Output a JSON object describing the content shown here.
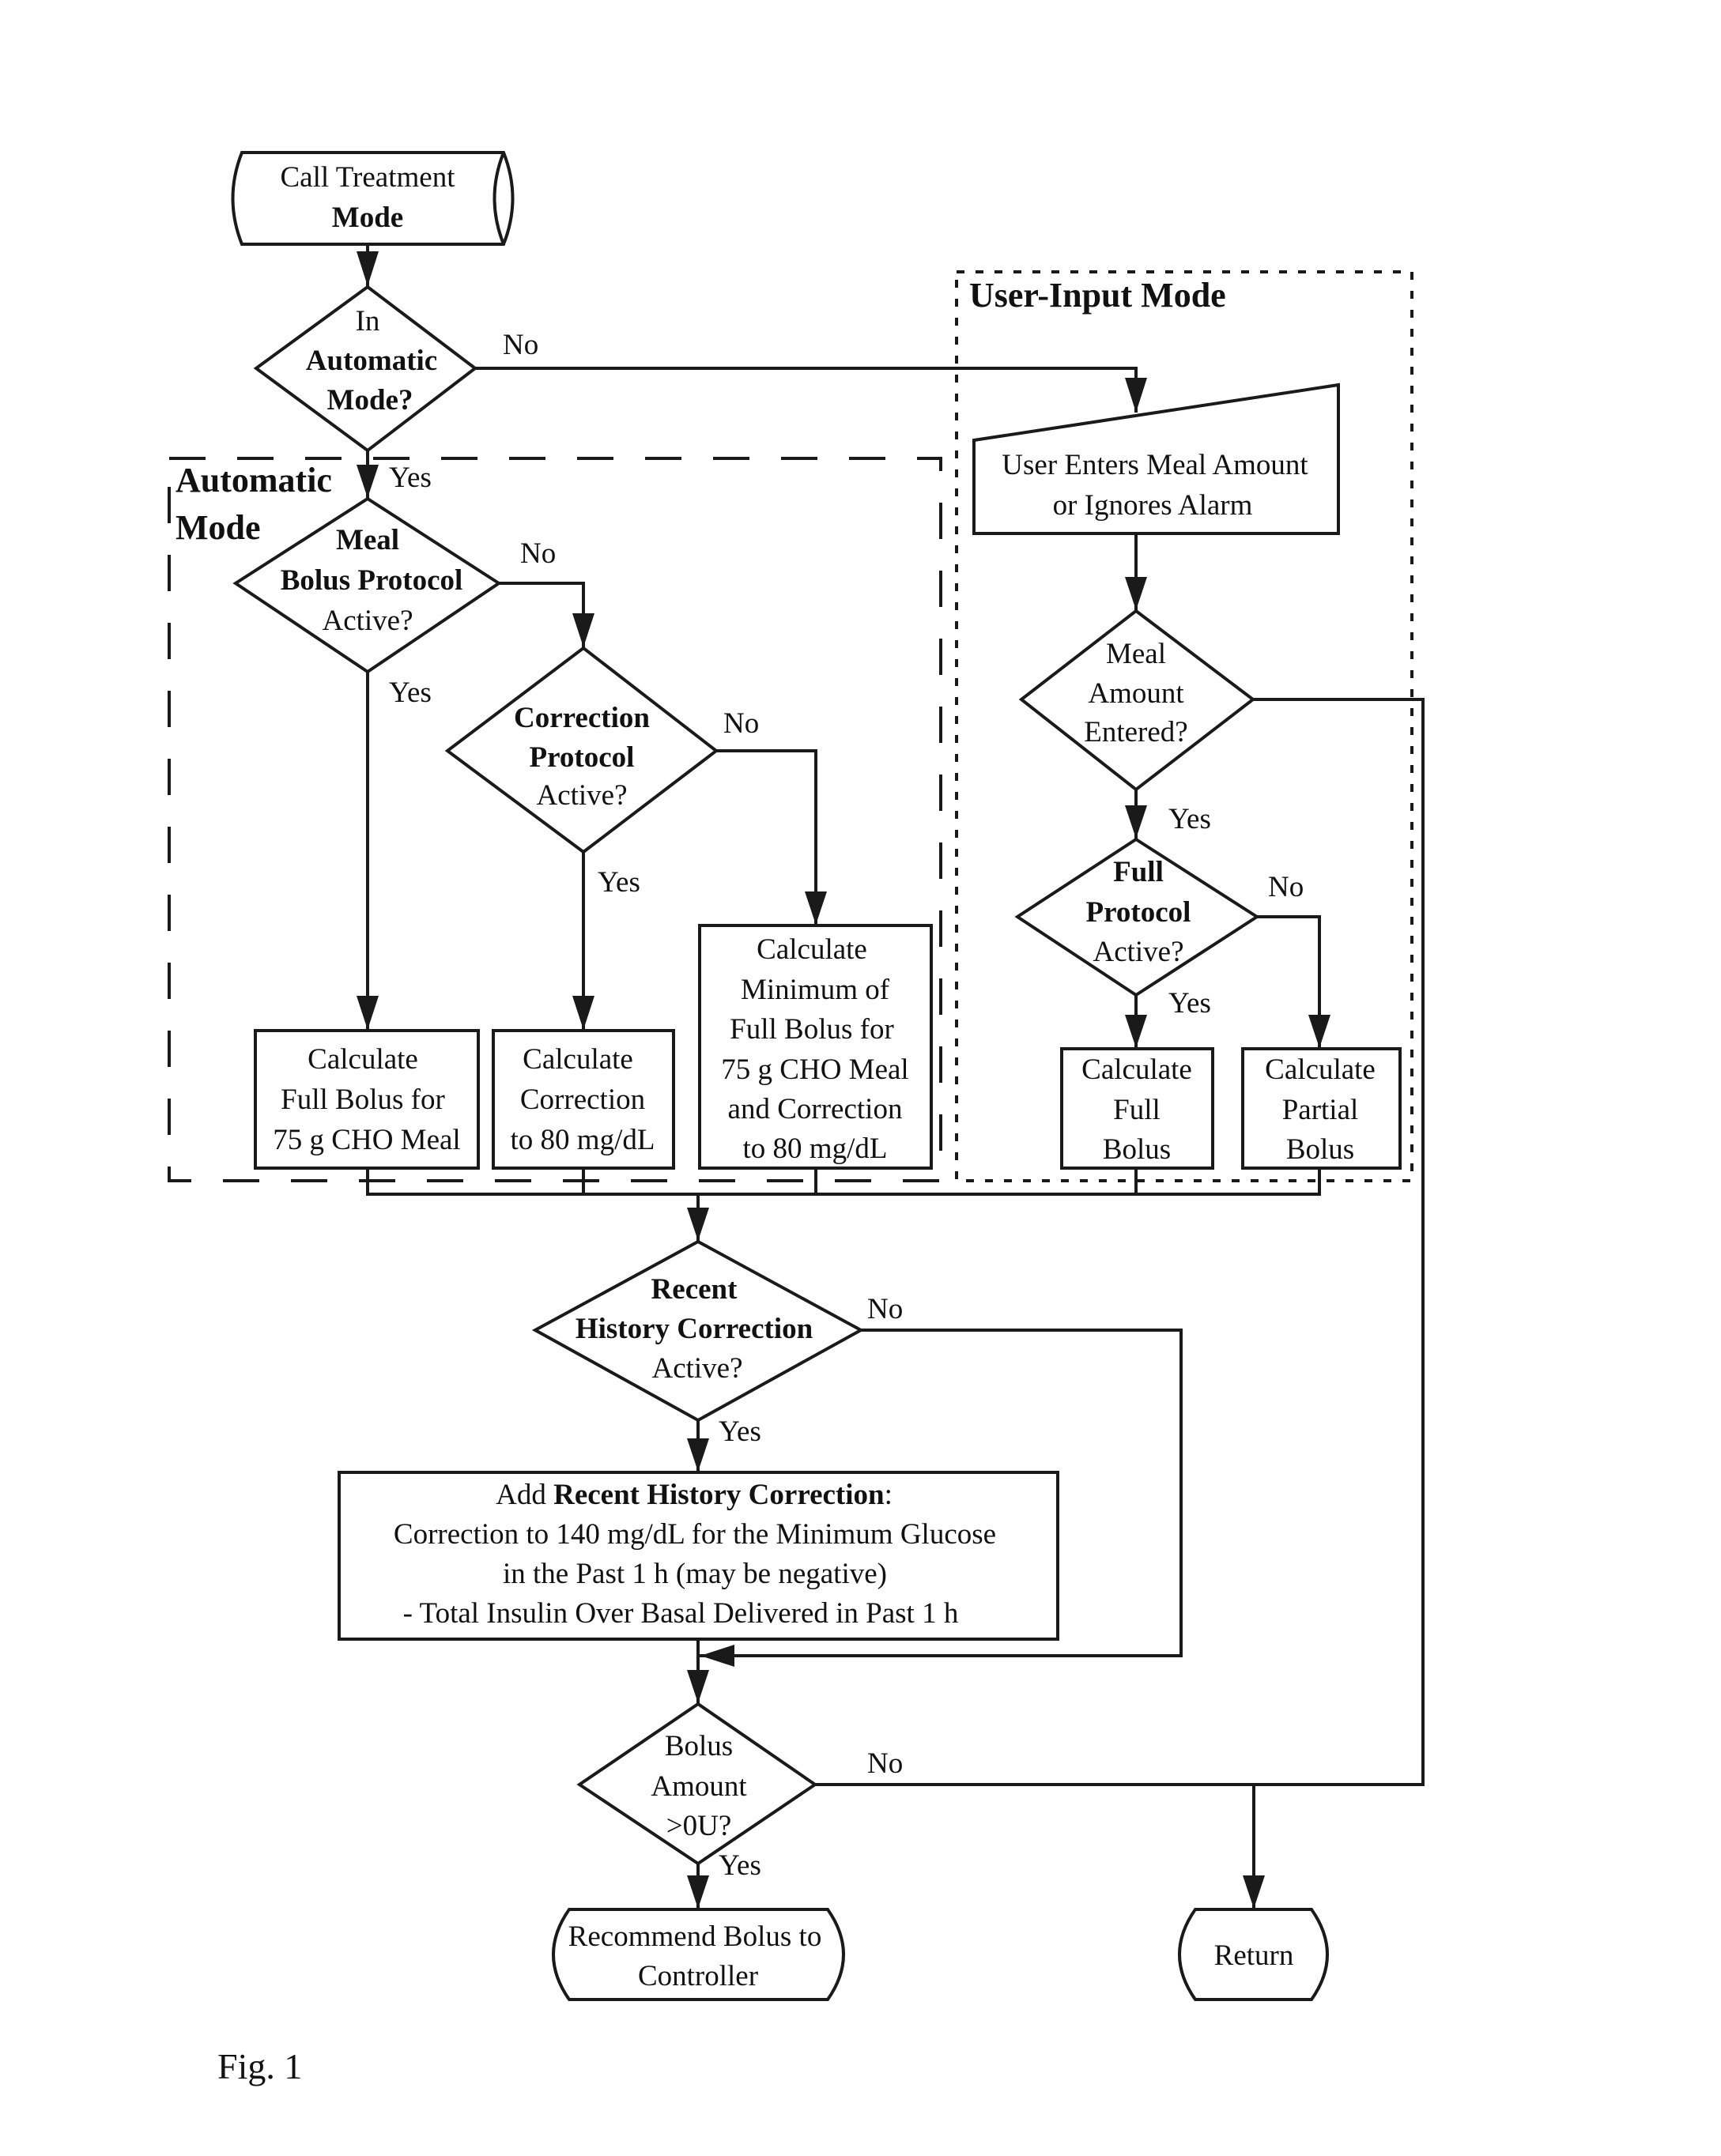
{
  "figure_label": "Fig. 1",
  "regions": {
    "automatic_mode": {
      "title_line1": "Automatic",
      "title_line2": "Mode"
    },
    "user_input_mode": {
      "title": "User-Input Mode"
    }
  },
  "nodes": {
    "start": {
      "line1": "Call Treatment",
      "line2": "Mode"
    },
    "in_automatic": {
      "line1": "In",
      "line2": "Automatic",
      "line3": "Mode?"
    },
    "meal_bolus_protocol": {
      "line1": "Meal",
      "line2": "Bolus Protocol",
      "line3": "Active?"
    },
    "correction_protocol": {
      "line1": "Correction",
      "line2": "Protocol",
      "line3": "Active?"
    },
    "calc_full_bolus_75": {
      "line1": "Calculate",
      "line2": "Full Bolus for",
      "line3": "75 g CHO Meal"
    },
    "calc_correction_80": {
      "line1": "Calculate",
      "line2": "Correction",
      "line3": "to 80 mg/dL"
    },
    "calc_minimum": {
      "line1": "Calculate",
      "line2": "Minimum of",
      "line3": "Full Bolus for",
      "line4": "75 g CHO Meal",
      "line5": "and Correction",
      "line6": "to 80 mg/dL"
    },
    "user_enters_meal": {
      "line1": "User Enters Meal Amount",
      "line2": "or Ignores Alarm"
    },
    "meal_amount_entered": {
      "line1": "Meal",
      "line2": "Amount",
      "line3": "Entered?"
    },
    "full_protocol": {
      "line1": "Full",
      "line2": "Protocol",
      "line3": "Active?"
    },
    "calc_full_bolus": {
      "line1": "Calculate",
      "line2": "Full",
      "line3": "Bolus"
    },
    "calc_partial_bolus": {
      "line1": "Calculate",
      "line2": "Partial",
      "line3": "Bolus"
    },
    "recent_history": {
      "line1": "Recent",
      "line2": "History Correction",
      "line3": "Active?"
    },
    "add_recent_history": {
      "line1_prefix": "Add ",
      "line1_bold": "Recent History Correction",
      "line1_suffix": ":",
      "line2": "Correction to 140 mg/dL for the Minimum Glucose",
      "line3": "in the Past 1 h (may be negative)",
      "line4": "- Total Insulin Over Basal Delivered in Past 1 h"
    },
    "bolus_amount": {
      "line1": "Bolus",
      "line2": "Amount",
      "line3": ">0U?"
    },
    "recommend_bolus": {
      "line1": "Recommend Bolus to",
      "line2": "Controller"
    },
    "return": {
      "line1": "Return"
    }
  },
  "edge_labels": {
    "in_automatic_no": "No",
    "in_automatic_yes": "Yes",
    "meal_bolus_no": "No",
    "meal_bolus_yes": "Yes",
    "correction_no": "No",
    "correction_yes": "Yes",
    "meal_amount_yes": "Yes",
    "full_protocol_no": "No",
    "full_protocol_yes": "Yes",
    "recent_history_no": "No",
    "recent_history_yes": "Yes",
    "bolus_amount_no": "No",
    "bolus_amount_yes": "Yes"
  }
}
